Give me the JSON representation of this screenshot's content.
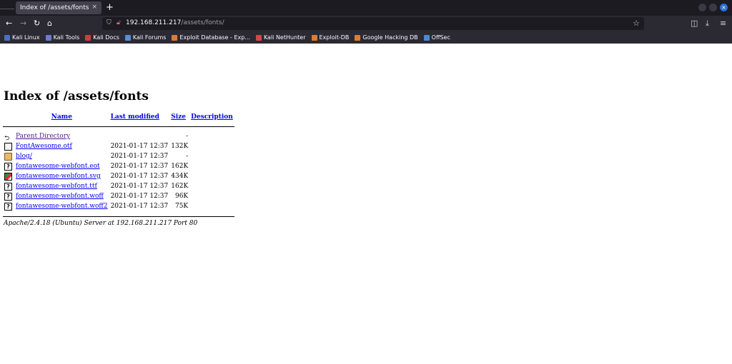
{
  "tab": {
    "title": "Index of /assets/fonts",
    "close": "×",
    "new": "+"
  },
  "nav": {
    "url_host": "192.168.211.217",
    "url_path": "/assets/fonts/"
  },
  "bookmarks": [
    {
      "label": "Kali Linux",
      "color": "#4b6fc2"
    },
    {
      "label": "Kali Tools",
      "color": "#6a7bd1"
    },
    {
      "label": "Kali Docs",
      "color": "#d33b3b"
    },
    {
      "label": "Kali Forums",
      "color": "#5a8cd6"
    },
    {
      "label": "Exploit Database - Exp...",
      "color": "#e07b2c"
    },
    {
      "label": "Kali NetHunter",
      "color": "#d84545"
    },
    {
      "label": "Exploit-DB",
      "color": "#e07b2c"
    },
    {
      "label": "Google Hacking DB",
      "color": "#e07b2c"
    },
    {
      "label": "OffSec",
      "color": "#4f86d9"
    }
  ],
  "page": {
    "heading": "Index of /assets/fonts",
    "columns": {
      "name": "Name",
      "modified": "Last modified",
      "size": "Size",
      "description": "Description"
    },
    "rows": [
      {
        "icon": "back-icon",
        "name": "Parent Directory",
        "modified": "",
        "size": "-"
      },
      {
        "icon": "file-icon",
        "name": "FontAwesome.otf",
        "modified": "2021-01-17 12:37",
        "size": "132K"
      },
      {
        "icon": "folder-icon",
        "name": "blog/",
        "modified": "2021-01-17 12:37",
        "size": "-"
      },
      {
        "icon": "unknown-icon",
        "name": "fontawesome-webfont.eot",
        "modified": "2021-01-17 12:37",
        "size": "162K"
      },
      {
        "icon": "image-icon",
        "name": "fontawesome-webfont.svg",
        "modified": "2021-01-17 12:37",
        "size": "434K"
      },
      {
        "icon": "unknown-icon",
        "name": "fontawesome-webfont.ttf",
        "modified": "2021-01-17 12:37",
        "size": "162K"
      },
      {
        "icon": "unknown-icon",
        "name": "fontawesome-webfont.woff",
        "modified": "2021-01-17 12:37",
        "size": "96K"
      },
      {
        "icon": "unknown-icon",
        "name": "fontawesome-webfont.woff2",
        "modified": "2021-01-17 12:37",
        "size": "75K"
      }
    ],
    "footer": "Apache/2.4.18 (Ubuntu) Server at 192.168.211.217 Port 80"
  }
}
